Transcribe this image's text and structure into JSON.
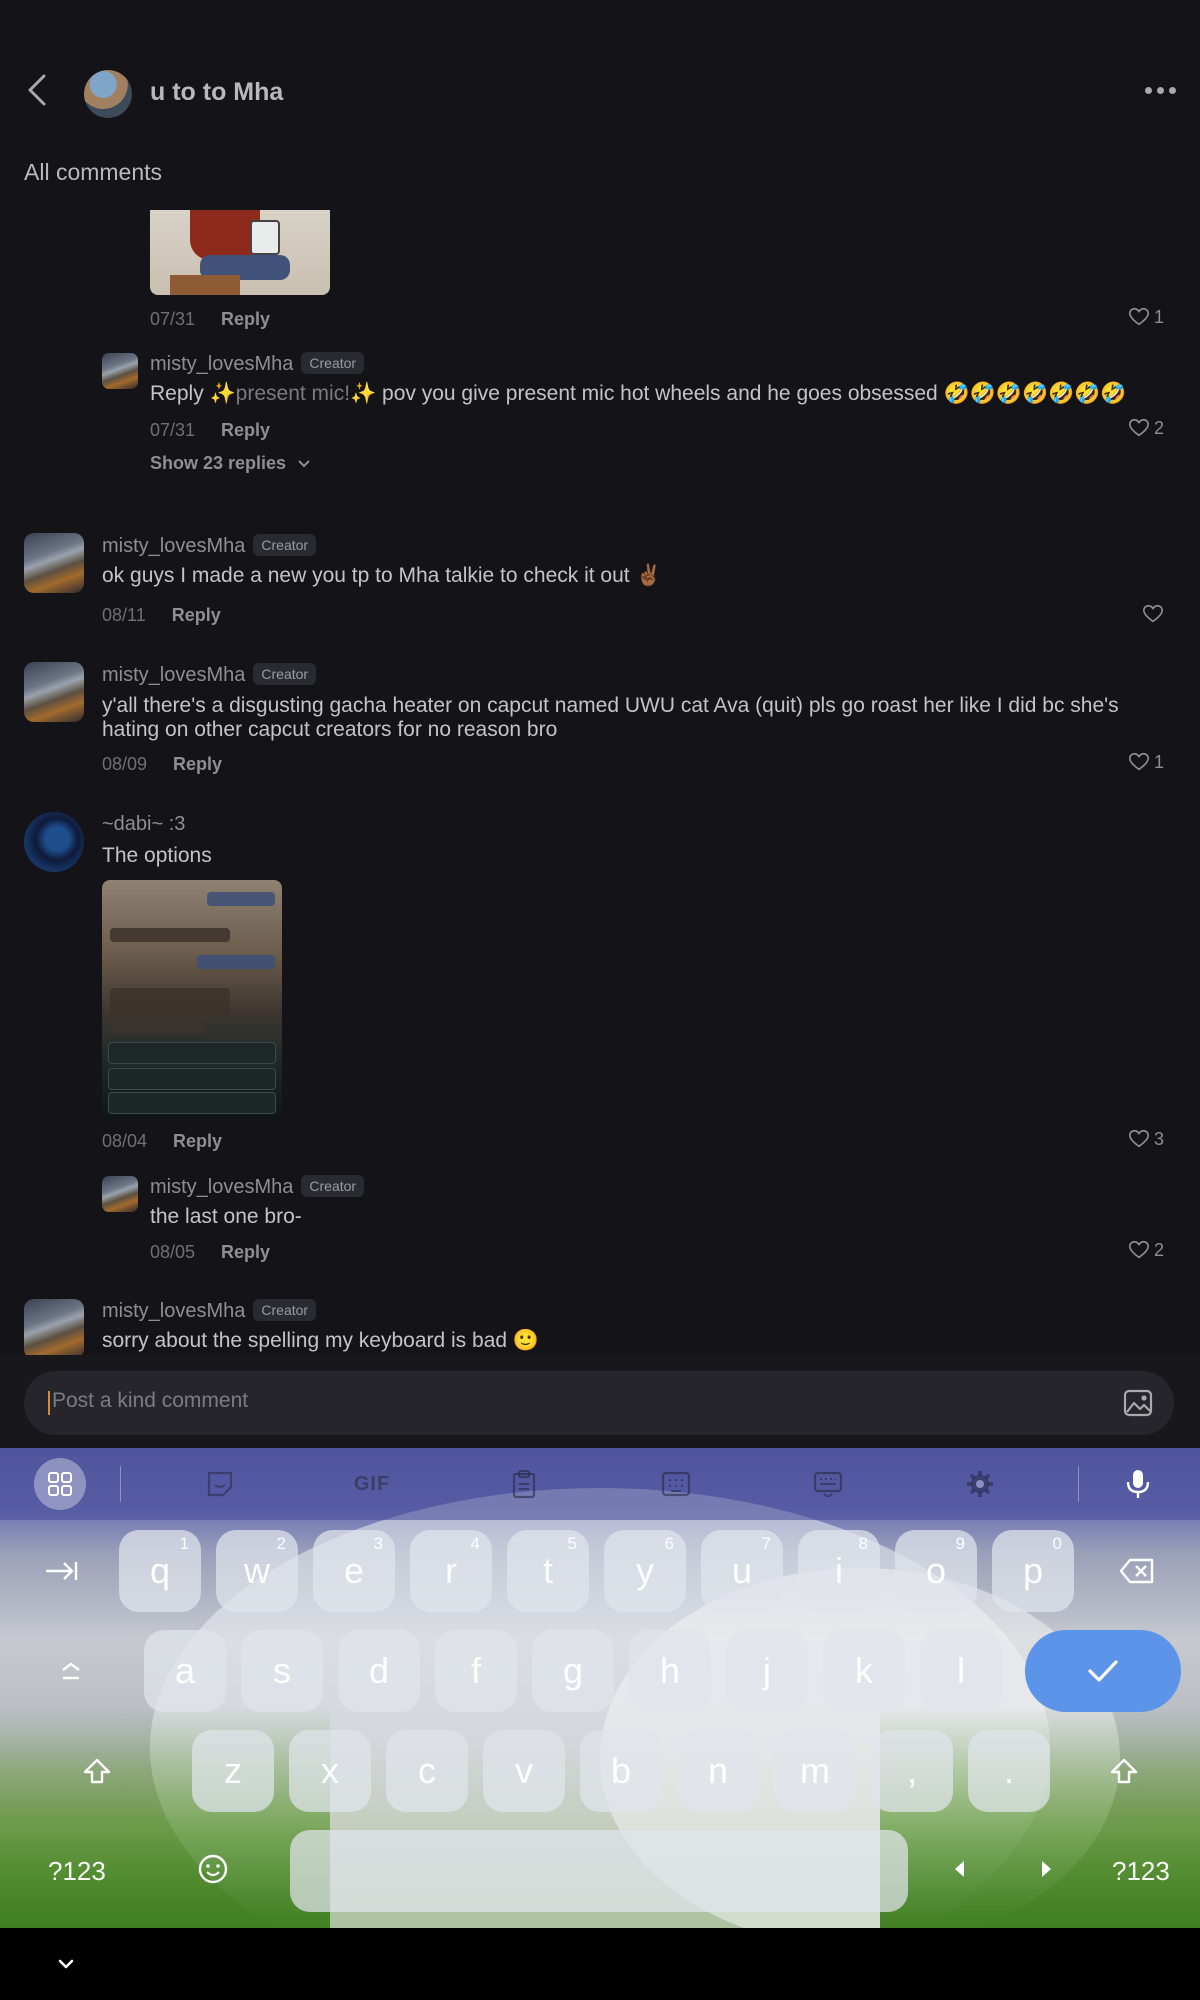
{
  "header": {
    "title": "u to to Mha"
  },
  "section_title": "All comments",
  "comments": {
    "c0": {
      "date": "07/31",
      "reply_label": "Reply",
      "likes": "1"
    },
    "r0": {
      "user": "misty_lovesMha",
      "badge": "Creator",
      "reply_prefix": "Reply ",
      "mention": "✨present mic!✨",
      "text": " pov you give present mic hot wheels and he goes obsessed 🤣🤣🤣🤣🤣🤣🤣",
      "date": "07/31",
      "reply_label": "Reply",
      "likes": "2",
      "show_replies": "Show 23 replies"
    },
    "c1": {
      "user": "misty_lovesMha",
      "badge": "Creator",
      "text": "ok guys I made a new you tp to Mha talkie to check it out ✌🏾",
      "date": "08/11",
      "reply_label": "Reply"
    },
    "c2": {
      "user": "misty_lovesMha",
      "badge": "Creator",
      "text": "y'all there's a disgusting gacha heater on capcut named UWU cat Ava (quit) pls go roast her like I did bc she's hating on other capcut creators for no reason bro",
      "date": "08/09",
      "reply_label": "Reply",
      "likes": "1"
    },
    "c3": {
      "user": "~dabi~ :3",
      "text": "The options",
      "date": "08/04",
      "reply_label": "Reply",
      "likes": "3"
    },
    "r3": {
      "user": "misty_lovesMha",
      "badge": "Creator",
      "text": "the last one bro-",
      "date": "08/05",
      "reply_label": "Reply",
      "likes": "2"
    },
    "c4": {
      "user": "misty_lovesMha",
      "badge": "Creator",
      "text": "sorry about the spelling my keyboard is bad 🙂"
    }
  },
  "input": {
    "placeholder": "Post a kind comment"
  },
  "keyboard": {
    "toolbar": [
      "apps-grid-icon",
      "sticker-icon",
      "GIF",
      "clipboard-icon",
      "numpad-icon",
      "keyboard-icon",
      "gear-icon",
      "mic-icon"
    ],
    "row1": [
      [
        "q",
        "1"
      ],
      [
        "w",
        "2"
      ],
      [
        "e",
        "3"
      ],
      [
        "r",
        "4"
      ],
      [
        "t",
        "5"
      ],
      [
        "y",
        "6"
      ],
      [
        "u",
        "7"
      ],
      [
        "i",
        "8"
      ],
      [
        "o",
        "9"
      ],
      [
        "p",
        "0"
      ]
    ],
    "row2": [
      "a",
      "s",
      "d",
      "f",
      "g",
      "h",
      "j",
      "k",
      "l"
    ],
    "row3": [
      "z",
      "x",
      "c",
      "v",
      "b",
      "n",
      "m",
      ",",
      "."
    ],
    "symbols_label": "?123",
    "colors": {
      "enter": "#5b94e8",
      "accent_caret": "#d88a3a"
    }
  }
}
